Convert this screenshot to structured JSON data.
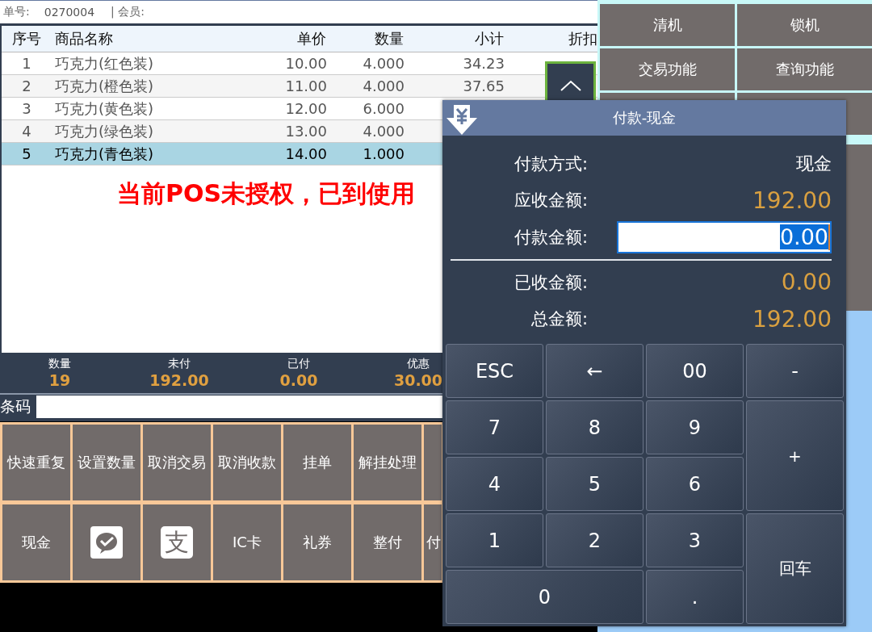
{
  "order": {
    "number_label": "单号:",
    "number": "0270004",
    "member_label": "| 会员:"
  },
  "table": {
    "columns": [
      "序号",
      "商品名称",
      "单价",
      "数量",
      "小计",
      "折扣"
    ],
    "rows": [
      {
        "cells": [
          "1",
          "巧克力(红色装)",
          "10.00",
          "4.000",
          "34.23"
        ],
        "selected": false
      },
      {
        "cells": [
          "2",
          "巧克力(橙色装)",
          "11.00",
          "4.000",
          "37.65"
        ],
        "selected": false
      },
      {
        "cells": [
          "3",
          "巧克力(黄色装)",
          "12.00",
          "6.000"
        ],
        "selected": false
      },
      {
        "cells": [
          "4",
          "巧克力(绿色装)",
          "13.00",
          "4.000"
        ],
        "selected": false
      },
      {
        "cells": [
          "5",
          "巧克力(青色装)",
          "14.00",
          "1.000"
        ],
        "selected": true
      }
    ]
  },
  "warning": "当前POS未授权，已到使用",
  "summary": [
    {
      "label": "数量",
      "value": "19"
    },
    {
      "label": "未付",
      "value": "192.00"
    },
    {
      "label": "已付",
      "value": "0.00"
    },
    {
      "label": "优惠",
      "value": "30.00"
    }
  ],
  "barcode": {
    "label": "条码"
  },
  "function_rows": [
    [
      {
        "kind": "text",
        "label": "快速重复"
      },
      {
        "kind": "text",
        "label": "设置数量"
      },
      {
        "kind": "text",
        "label": "取消交易"
      },
      {
        "kind": "text",
        "label": "取消收款"
      },
      {
        "kind": "text",
        "label": "挂单"
      },
      {
        "kind": "text",
        "label": "解挂处理"
      },
      {
        "kind": "blank"
      }
    ],
    [
      {
        "kind": "text",
        "label": "现金"
      },
      {
        "kind": "chat"
      },
      {
        "kind": "badge",
        "label": "支"
      },
      {
        "kind": "text",
        "label": "IC卡"
      },
      {
        "kind": "text",
        "label": "礼券"
      },
      {
        "kind": "text",
        "label": "整付"
      },
      {
        "kind": "text",
        "label": "付"
      }
    ]
  ],
  "side_buttons": [
    "清机",
    "锁机",
    "交易功能",
    "查询功能"
  ],
  "dialog": {
    "title": "付款-现金",
    "fields": [
      {
        "kind": "text",
        "label": "付款方式:",
        "value": "现金"
      },
      {
        "kind": "amount",
        "label": "应收金额:",
        "value": "192.00"
      },
      {
        "kind": "input",
        "label": "付款金额:",
        "value": "0.00"
      },
      {
        "kind": "amount",
        "label": "已收金额:",
        "value": "0.00"
      },
      {
        "kind": "amount",
        "label": "总金额:",
        "value": "192.00"
      }
    ],
    "keys": [
      {
        "kind": "normal",
        "label": "ESC"
      },
      {
        "kind": "normal",
        "label": "←"
      },
      {
        "kind": "normal",
        "label": "00"
      },
      {
        "kind": "normal",
        "label": "-"
      },
      {
        "kind": "normal",
        "label": "7"
      },
      {
        "kind": "normal",
        "label": "8"
      },
      {
        "kind": "normal",
        "label": "9"
      },
      {
        "kind": "tall",
        "label": "+"
      },
      {
        "kind": "normal",
        "label": "4"
      },
      {
        "kind": "normal",
        "label": "5"
      },
      {
        "kind": "normal",
        "label": "6"
      },
      {
        "kind": "normal",
        "label": "1"
      },
      {
        "kind": "normal",
        "label": "2"
      },
      {
        "kind": "normal",
        "label": "3"
      },
      {
        "kind": "tall",
        "label": "回车"
      },
      {
        "kind": "wide",
        "label": "0"
      },
      {
        "kind": "normal",
        "label": "."
      }
    ]
  }
}
